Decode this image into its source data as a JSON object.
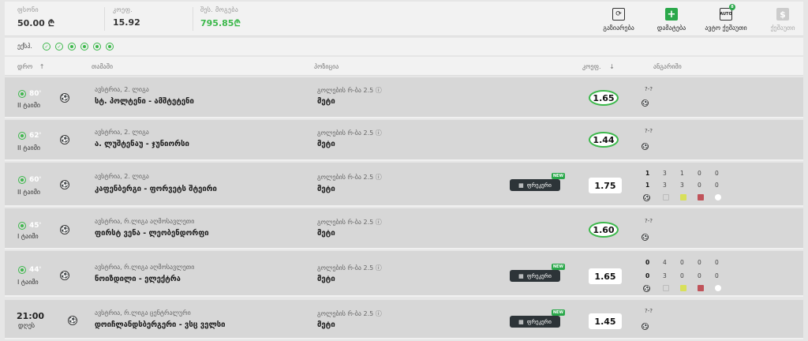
{
  "header": {
    "stake_label": "ფსონი",
    "stake_value": "50.00 ₾",
    "coef_label": "კოეფ.",
    "coef_value": "15.92",
    "payout_label": "შეს. მოგება",
    "payout_value": "795.85₾",
    "actions": [
      {
        "label": "გაზიარება",
        "icon": "refresh-icon"
      },
      {
        "label": "დამატება",
        "icon": "plus-icon"
      },
      {
        "label": "ავტო ქეშაუთი",
        "icon": "auto-icon",
        "badge": "8"
      },
      {
        "label": "ქეშაუთი",
        "icon": "cash-icon"
      }
    ],
    "auto_text": "AUTO"
  },
  "tokens_label": "ექსპ.",
  "columns": {
    "time": "დრო",
    "match": "თამაში",
    "market": "პოზიცია",
    "coef": "კოეფ.",
    "score": "ანგარიში"
  },
  "frog_label": "ფრეკერი",
  "new_label": "NEW",
  "rows": [
    {
      "minute": "80'",
      "period": "II ტაიმი",
      "league": "ავსტრია, 2. ლიგა",
      "match": "სტ. პოლტენი - ამშტეტენი",
      "market": "გოლების რ-ბა 2.5 ⓘ",
      "selection": "მეტი",
      "odd": "1.65",
      "style": "oval",
      "q": "?-?"
    },
    {
      "minute": "62'",
      "period": "II ტაიმი",
      "league": "ავსტრია, 2. ლიგა",
      "match": "ა. ლუშტენაუ - ჯუნიორსი",
      "market": "გოლების რ-ბა 2.5 ⓘ",
      "selection": "მეტი",
      "odd": "1.44",
      "style": "oval",
      "q": "?-?"
    },
    {
      "minute": "60'",
      "period": "II ტაიმი",
      "league": "ავსტრია, 2. ლიგა",
      "match": "კაფენბერგი - ფორვეტს შტეირი",
      "market": "გოლების რ-ბა 2.5 ⓘ",
      "selection": "მეტი",
      "odd": "1.75",
      "style": "box",
      "frog": true,
      "stats1": [
        "1",
        "3",
        "1",
        "0",
        "0"
      ],
      "stats2": [
        "1",
        "3",
        "3",
        "0",
        "0"
      ]
    },
    {
      "minute": "45'",
      "period": "I ტაიმი",
      "league": "ავსტრია, რ.ლიგა აღმოსავლეთი",
      "match": "ფირსტ ვენა - ლეობენდორფი",
      "market": "გოლების რ-ბა 2.5 ⓘ",
      "selection": "მეტი",
      "odd": "1.60",
      "style": "oval",
      "q": "?-?"
    },
    {
      "minute": "44'",
      "period": "I ტაიმი",
      "league": "ავსტრია, რ.ლიგა აღმოსავლეთი",
      "match": "ნოიზდილი - ელექტრა",
      "market": "გოლების რ-ბა 2.5 ⓘ",
      "selection": "მეტი",
      "odd": "1.65",
      "style": "box",
      "frog": true,
      "stats1": [
        "0",
        "4",
        "0",
        "0",
        "0"
      ],
      "stats2": [
        "0",
        "3",
        "0",
        "0",
        "0"
      ]
    },
    {
      "kickoff": "21:00",
      "day": "დღეს",
      "league": "ავსტრია, რ.ლიგა ცენტრალური",
      "match": "დოიჩლანდსბერგერი - ვსც ველსი",
      "market": "გოლების რ-ბა 2.5 ⓘ",
      "selection": "მეტი",
      "odd": "1.45",
      "style": "box",
      "frog": true,
      "q": "?-?"
    }
  ]
}
